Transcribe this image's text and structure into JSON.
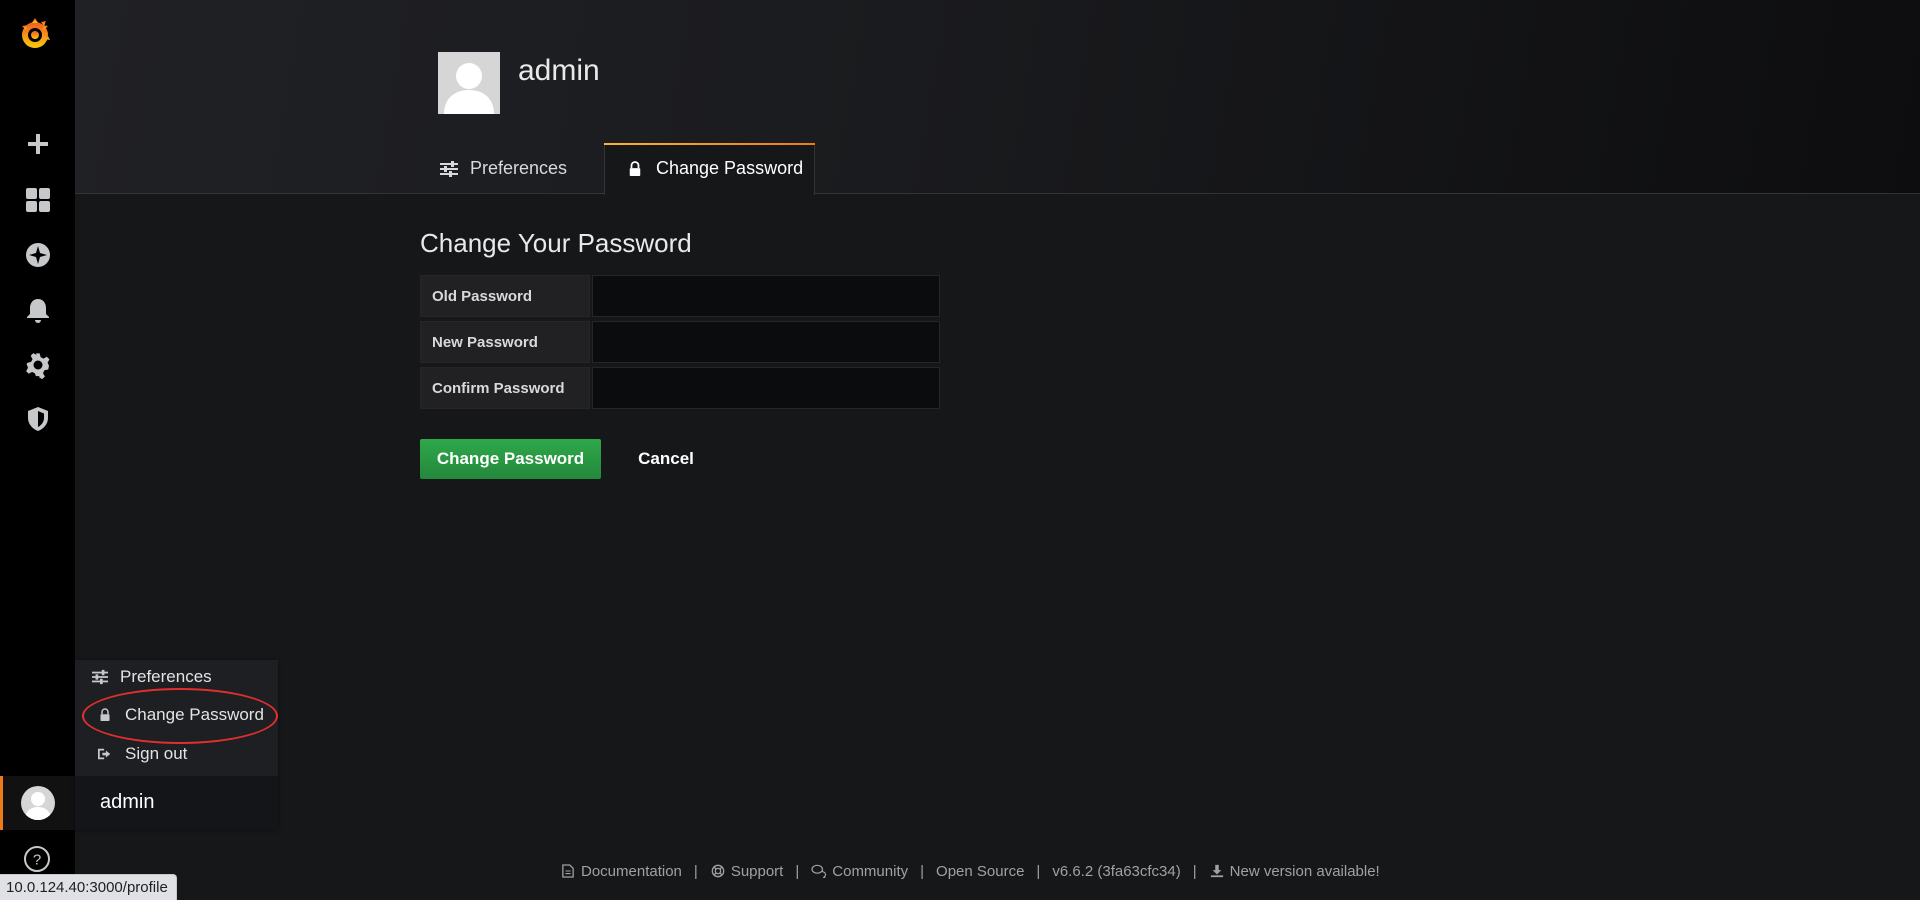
{
  "header": {
    "title": "admin"
  },
  "tabs": [
    {
      "label": "Preferences",
      "icon": "sliders-icon",
      "active": false
    },
    {
      "label": "Change Password",
      "icon": "lock-icon",
      "active": true
    }
  ],
  "form": {
    "title": "Change Your Password",
    "fields": [
      {
        "label": "Old Password",
        "value": ""
      },
      {
        "label": "New Password",
        "value": ""
      },
      {
        "label": "Confirm Password",
        "value": ""
      }
    ],
    "submit_label": "Change Password",
    "cancel_label": "Cancel"
  },
  "user_menu": {
    "items": [
      {
        "label": "Preferences",
        "icon": "sliders-icon"
      },
      {
        "label": "Change Password",
        "icon": "lock-icon"
      },
      {
        "label": "Sign out",
        "icon": "sign-out-icon"
      }
    ],
    "user_name": "admin"
  },
  "sidebar": {
    "icons": [
      "grafana-logo",
      "plus-icon",
      "dashboards-icon",
      "explore-icon",
      "bell-icon",
      "gear-icon",
      "shield-icon",
      "help-icon"
    ]
  },
  "footer": {
    "links": [
      {
        "label": "Documentation",
        "icon": "document-icon"
      },
      {
        "label": "Support",
        "icon": "lifebuoy-icon"
      },
      {
        "label": "Community",
        "icon": "comments-icon"
      },
      {
        "label": "Open Source",
        "icon": ""
      },
      {
        "label": "v6.6.2 (3fa63cfc34)",
        "icon": ""
      },
      {
        "label": "New version available!",
        "icon": "download-icon"
      }
    ]
  },
  "status_bar": {
    "url": "10.0.124.40:3000/profile"
  },
  "colors": {
    "accent": "#eb7b18",
    "primary_button": "#2b9a45",
    "highlight": "#e02f2f",
    "background": "#161719",
    "sidebar": "#000000"
  }
}
